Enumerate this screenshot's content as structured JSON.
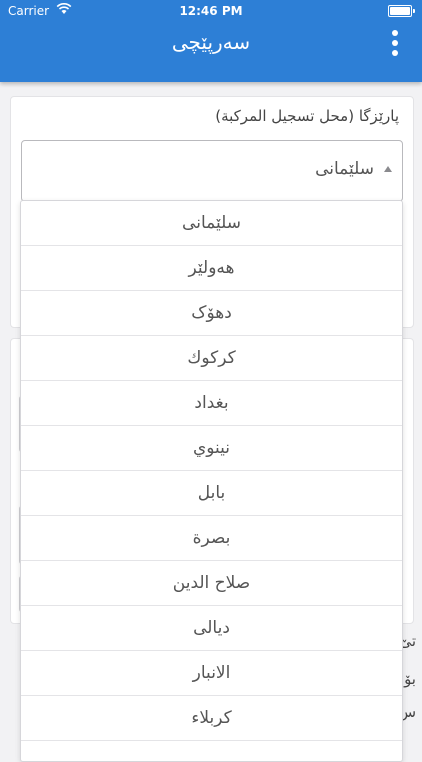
{
  "status_bar": {
    "carrier": "Carrier",
    "time": "12:46 PM"
  },
  "header": {
    "title": "سەرپێچی"
  },
  "registration_field": {
    "label": "پارێزگا (محل تسجيل المركبة)",
    "selected_value": "سلێمانی"
  },
  "dropdown": {
    "options": [
      "سلێمانی",
      "هەولێر",
      "دهۆک",
      "کرکوك",
      "بغداد",
      "نينوي",
      "بابل",
      "بصرة",
      "صلاح الدين",
      "ديالى",
      "الانبار",
      "كربلاء"
    ]
  },
  "background_text": {
    "line1": "تێ",
    "line2": "بۆ",
    "line3": "س"
  },
  "colors": {
    "header_bg": "#2d7fd6",
    "page_bg": "#f2f2f4"
  }
}
